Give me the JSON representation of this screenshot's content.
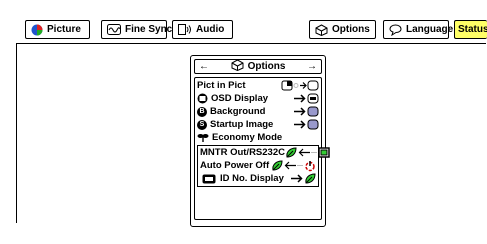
{
  "tabs": [
    {
      "label": "Picture",
      "icon": "picture-icon"
    },
    {
      "label": "Fine Sync",
      "icon": "fine-sync-icon"
    },
    {
      "label": "Audio",
      "icon": "speaker-icon"
    },
    {
      "label": "Options",
      "icon": "options-icon"
    },
    {
      "label": "Language",
      "icon": "speech-bubble-icon"
    },
    {
      "label": "Status",
      "icon": ""
    }
  ],
  "menu": {
    "title": "Options",
    "items": [
      {
        "label": "Pict in Pict"
      },
      {
        "label": "OSD Display"
      },
      {
        "label": "Background",
        "badge": "B"
      },
      {
        "label": "Startup Image",
        "badge": "S"
      },
      {
        "label": "Economy Mode"
      }
    ],
    "economy": [
      {
        "label": "MNTR Out/RS232C"
      },
      {
        "label": "Auto Power Off"
      }
    ],
    "id_item": {
      "label": "ID No. Display"
    }
  },
  "colors": {
    "accent": "#ffff66",
    "green": "#33cc33",
    "lavender": "#9999cc",
    "red": "#cc0000"
  }
}
